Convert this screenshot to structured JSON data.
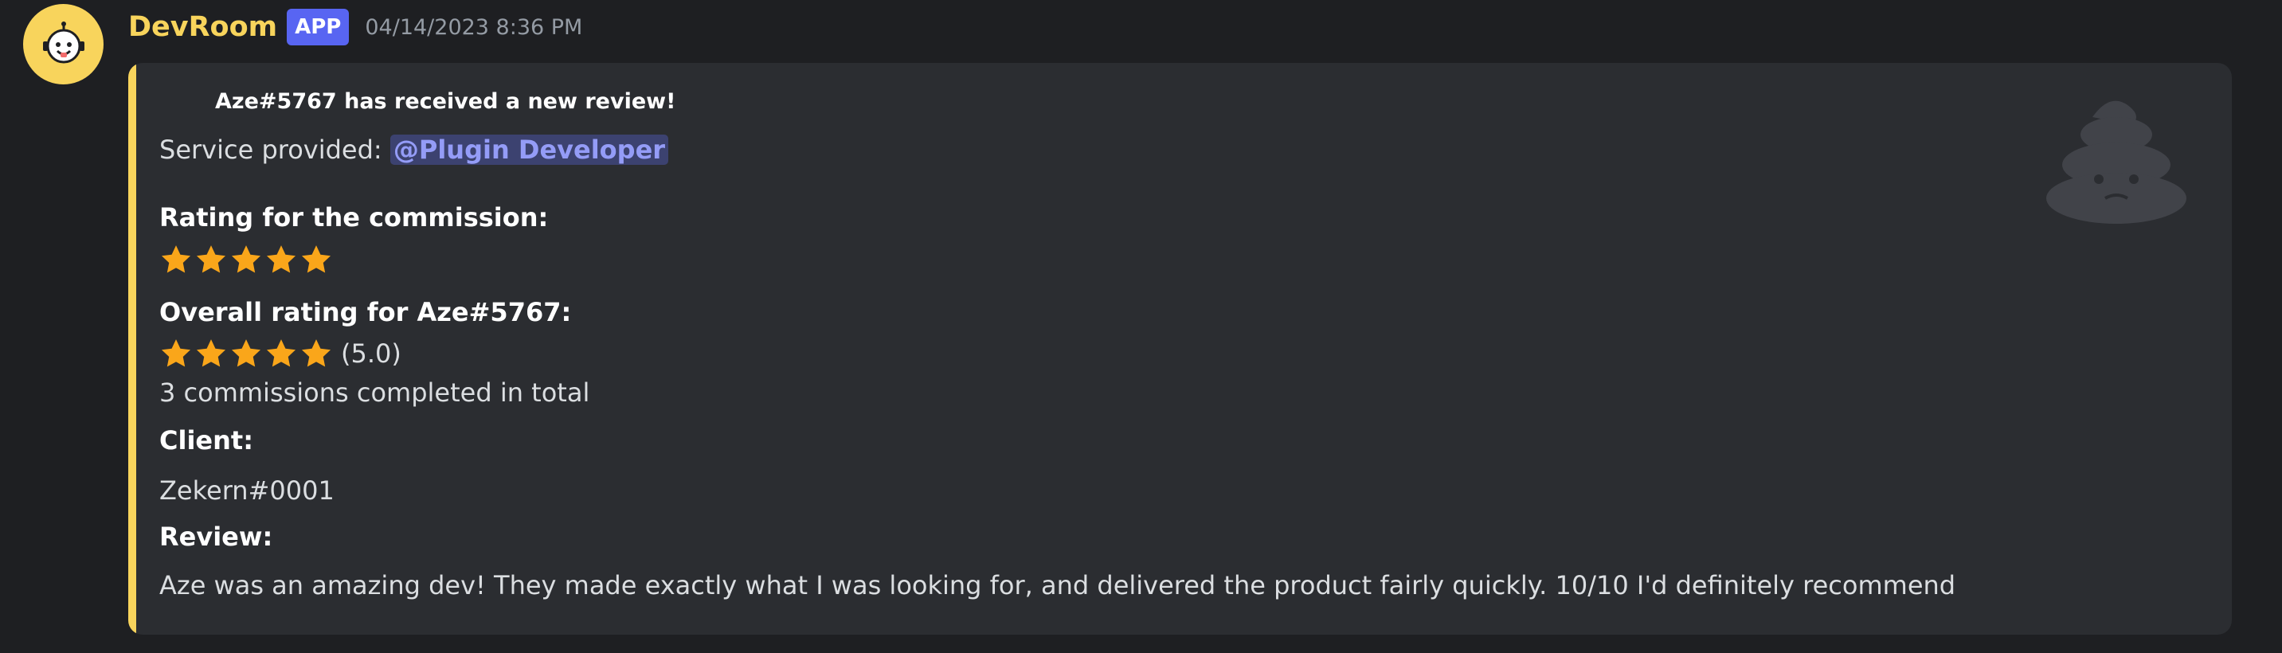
{
  "message": {
    "username": "DevRoom",
    "tag": "APP",
    "timestamp": "04/14/2023 8:36 PM",
    "avatar_icon": "bot-face-icon",
    "accent_color": "#f8d45c"
  },
  "embed": {
    "author_line": "Aze#5767 has received a new review!",
    "service_label": "Service provided: ",
    "service_role": "@Plugin Developer",
    "commission_rating_label": "Rating for the commission:",
    "commission_stars": 5,
    "overall_label": "Overall rating for Aze#5767:",
    "overall_stars": 5,
    "overall_value": "(5.0)",
    "commissions_total": "3 commissions completed in total",
    "client_label": "Client:",
    "client_value": "Zekern#0001",
    "review_label": "Review:",
    "review_text": "Aze was an amazing dev! They made exactly what I was looking for, and delivered the product fairly quickly. 10/10 I'd definitely recommend",
    "thumbnail_icon": "sad-poop-icon",
    "star_color": "#faa61a"
  }
}
